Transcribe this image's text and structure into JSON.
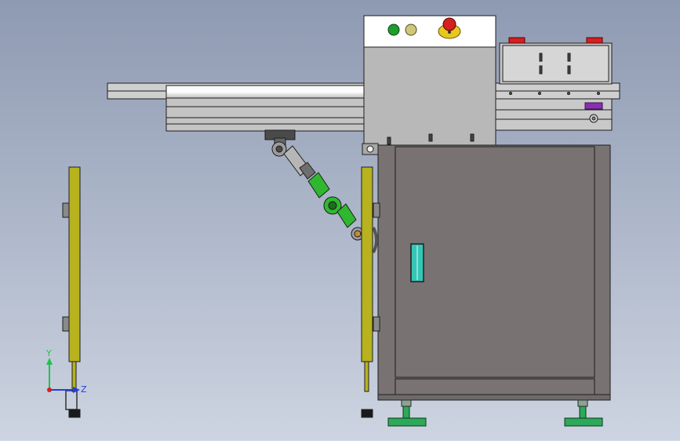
{
  "axes_triad": {
    "y_label": "Y",
    "z_label": "Z"
  },
  "colors": {
    "background_top": "#8e9ab2",
    "background_bottom": "#cdd4e1",
    "cabinet": "#787272",
    "housing": "#b8b8b8",
    "rail": "#d2d2d2",
    "post": "#b7b21e",
    "arm_green": "#2fb82f",
    "foot_green": "#2ea85a",
    "window_teal": "#34c6b6",
    "estop_red": "#d42020",
    "purple_tag": "#8a2fb0",
    "axis_y": "#22c24a",
    "axis_z": "#1f3ee0",
    "outline": "#1e1e1e"
  },
  "control_panel": {
    "buttons": [
      {
        "name": "green-push-button",
        "color": "#1e9e2a"
      },
      {
        "name": "yellow-push-button",
        "color": "#cfc77a"
      },
      {
        "name": "emergency-stop-button",
        "color": "#d42020"
      }
    ]
  }
}
